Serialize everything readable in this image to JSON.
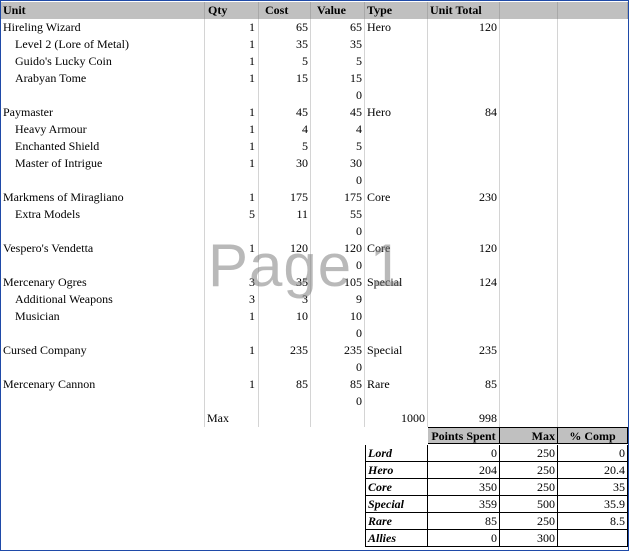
{
  "header": {
    "unit": "Unit",
    "qty": "Qty",
    "cost": "Cost",
    "value": "Value",
    "type": "Type",
    "unit_total": "Unit Total"
  },
  "rows": [
    {
      "name": "Hireling Wizard",
      "indent": false,
      "qty": "1",
      "cost": "65",
      "value": "65",
      "type": "Hero",
      "total": "120"
    },
    {
      "name": "Level 2 (Lore of Metal)",
      "indent": true,
      "qty": "1",
      "cost": "35",
      "value": "35",
      "type": "",
      "total": ""
    },
    {
      "name": "Guido's Lucky Coin",
      "indent": true,
      "qty": "1",
      "cost": "5",
      "value": "5",
      "type": "",
      "total": ""
    },
    {
      "name": "Arabyan Tome",
      "indent": true,
      "qty": "1",
      "cost": "15",
      "value": "15",
      "type": "",
      "total": ""
    },
    {
      "name": "",
      "indent": false,
      "qty": "",
      "cost": "",
      "value": "0",
      "type": "",
      "total": ""
    },
    {
      "name": "Paymaster",
      "indent": false,
      "qty": "1",
      "cost": "45",
      "value": "45",
      "type": "Hero",
      "total": "84"
    },
    {
      "name": "Heavy Armour",
      "indent": true,
      "qty": "1",
      "cost": "4",
      "value": "4",
      "type": "",
      "total": ""
    },
    {
      "name": "Enchanted Shield",
      "indent": true,
      "qty": "1",
      "cost": "5",
      "value": "5",
      "type": "",
      "total": ""
    },
    {
      "name": "Master of Intrigue",
      "indent": true,
      "qty": "1",
      "cost": "30",
      "value": "30",
      "type": "",
      "total": ""
    },
    {
      "name": "",
      "indent": false,
      "qty": "",
      "cost": "",
      "value": "0",
      "type": "",
      "total": ""
    },
    {
      "name": "Markmens of Miragliano",
      "indent": false,
      "qty": "1",
      "cost": "175",
      "value": "175",
      "type": "Core",
      "total": "230"
    },
    {
      "name": "Extra Models",
      "indent": true,
      "qty": "5",
      "cost": "11",
      "value": "55",
      "type": "",
      "total": ""
    },
    {
      "name": "",
      "indent": false,
      "qty": "",
      "cost": "",
      "value": "0",
      "type": "",
      "total": ""
    },
    {
      "name": "Vespero's Vendetta",
      "indent": false,
      "qty": "1",
      "cost": "120",
      "value": "120",
      "type": "Core",
      "total": "120"
    },
    {
      "name": "",
      "indent": false,
      "qty": "",
      "cost": "",
      "value": "0",
      "type": "",
      "total": ""
    },
    {
      "name": "Mercenary Ogres",
      "indent": false,
      "qty": "3",
      "cost": "35",
      "value": "105",
      "type": "Special",
      "total": "124"
    },
    {
      "name": "Additional Weapons",
      "indent": true,
      "qty": "3",
      "cost": "3",
      "value": "9",
      "type": "",
      "total": ""
    },
    {
      "name": "Musician",
      "indent": true,
      "qty": "1",
      "cost": "10",
      "value": "10",
      "type": "",
      "total": ""
    },
    {
      "name": "",
      "indent": false,
      "qty": "",
      "cost": "",
      "value": "0",
      "type": "",
      "total": ""
    },
    {
      "name": "Cursed Company",
      "indent": false,
      "qty": "1",
      "cost": "235",
      "value": "235",
      "type": "Special",
      "total": "235"
    },
    {
      "name": "",
      "indent": false,
      "qty": "",
      "cost": "",
      "value": "0",
      "type": "",
      "total": ""
    },
    {
      "name": "Mercenary Cannon",
      "indent": false,
      "qty": "1",
      "cost": "85",
      "value": "85",
      "type": "Rare",
      "total": "85"
    },
    {
      "name": "",
      "indent": false,
      "qty": "",
      "cost": "",
      "value": "0",
      "type": "",
      "total": ""
    }
  ],
  "totals": {
    "max_label": "Max",
    "max_value": "1000",
    "grand_total": "998"
  },
  "summary": {
    "headers": {
      "points_spent": "Points Spent",
      "max": "Max",
      "pct_comp": "% Comp"
    },
    "rows": [
      {
        "cat": "Lord",
        "spent": "0",
        "max": "250",
        "pct": "0"
      },
      {
        "cat": "Hero",
        "spent": "204",
        "max": "250",
        "pct": "20.4"
      },
      {
        "cat": "Core",
        "spent": "350",
        "max": "250",
        "pct": "35"
      },
      {
        "cat": "Special",
        "spent": "359",
        "max": "500",
        "pct": "35.9"
      },
      {
        "cat": "Rare",
        "spent": "85",
        "max": "250",
        "pct": "8.5"
      },
      {
        "cat": "Allies",
        "spent": "0",
        "max": "300",
        "pct": ""
      }
    ]
  },
  "watermark": "Page 1",
  "colors": {
    "header_bg": "#c0c0c0",
    "grid": "#d4d4d4",
    "frame": "#1f4aa8"
  }
}
